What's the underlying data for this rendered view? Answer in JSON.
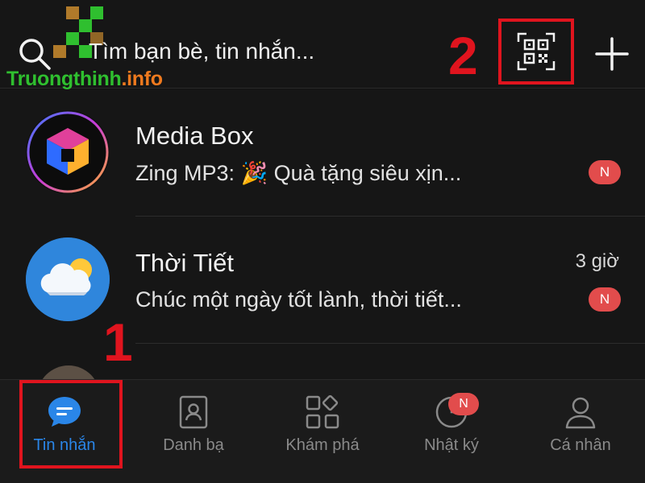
{
  "header": {
    "search_placeholder": "Tìm bạn bè, tin nhắn..."
  },
  "watermark": {
    "part1": "Truongthinh",
    "part2": ".info"
  },
  "annotations": {
    "step1": "1",
    "step2": "2"
  },
  "conversations": [
    {
      "title": "Media Box",
      "preview": "Zing MP3: 🎉 Quà tặng siêu xịn...",
      "time": "",
      "badge": "N"
    },
    {
      "title": "Thời Tiết",
      "preview": "Chúc một ngày tốt lành, thời tiết...",
      "time": "3 giờ",
      "badge": "N"
    }
  ],
  "tabs": [
    {
      "label": "Tin nhắn",
      "active": true
    },
    {
      "label": "Danh bạ",
      "active": false
    },
    {
      "label": "Khám phá",
      "active": false
    },
    {
      "label": "Nhật ký",
      "active": false,
      "badge": "N"
    },
    {
      "label": "Cá nhân",
      "active": false
    }
  ],
  "colors": {
    "accent": "#2a86e8",
    "badge": "#e24c4c",
    "annotation": "#e0141e"
  }
}
